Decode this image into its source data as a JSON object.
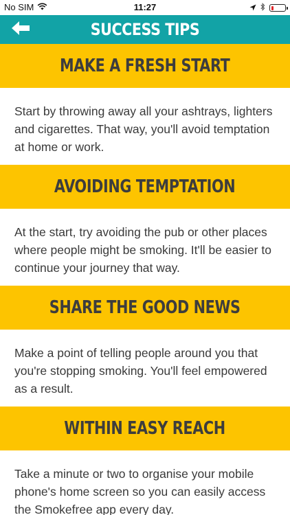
{
  "status_bar": {
    "carrier": "No SIM",
    "time": "11:27",
    "icons": [
      "wifi-icon",
      "location-arrow-icon",
      "bluetooth-icon",
      "battery-low-icon"
    ],
    "battery_color": "#e0262a"
  },
  "nav": {
    "title": "SUCCESS TIPS",
    "back_icon": "arrow-left-icon",
    "background": "#12a3a6"
  },
  "tips": [
    {
      "title": "MAKE A FRESH START",
      "body": "Start by throwing away all your ashtrays, lighters and cigarettes. That way, you'll avoid temptation at home or work."
    },
    {
      "title": "AVOIDING TEMPTATION",
      "body": "At the start, try avoiding the pub or other places where people might be smoking. It'll be easier to continue your journey that way."
    },
    {
      "title": "SHARE THE GOOD NEWS",
      "body": "Make a point of telling people around you that you're stopping smoking. You'll feel empowered as a result."
    },
    {
      "title": "WITHIN EASY REACH",
      "body": "Take a minute or two to organise your mobile phone's home screen so you can easily access the Smokefree app every day."
    }
  ],
  "colors": {
    "header_yellow": "#fdc400",
    "header_text": "#3d3d3d",
    "body_text": "#3a3a3a"
  }
}
